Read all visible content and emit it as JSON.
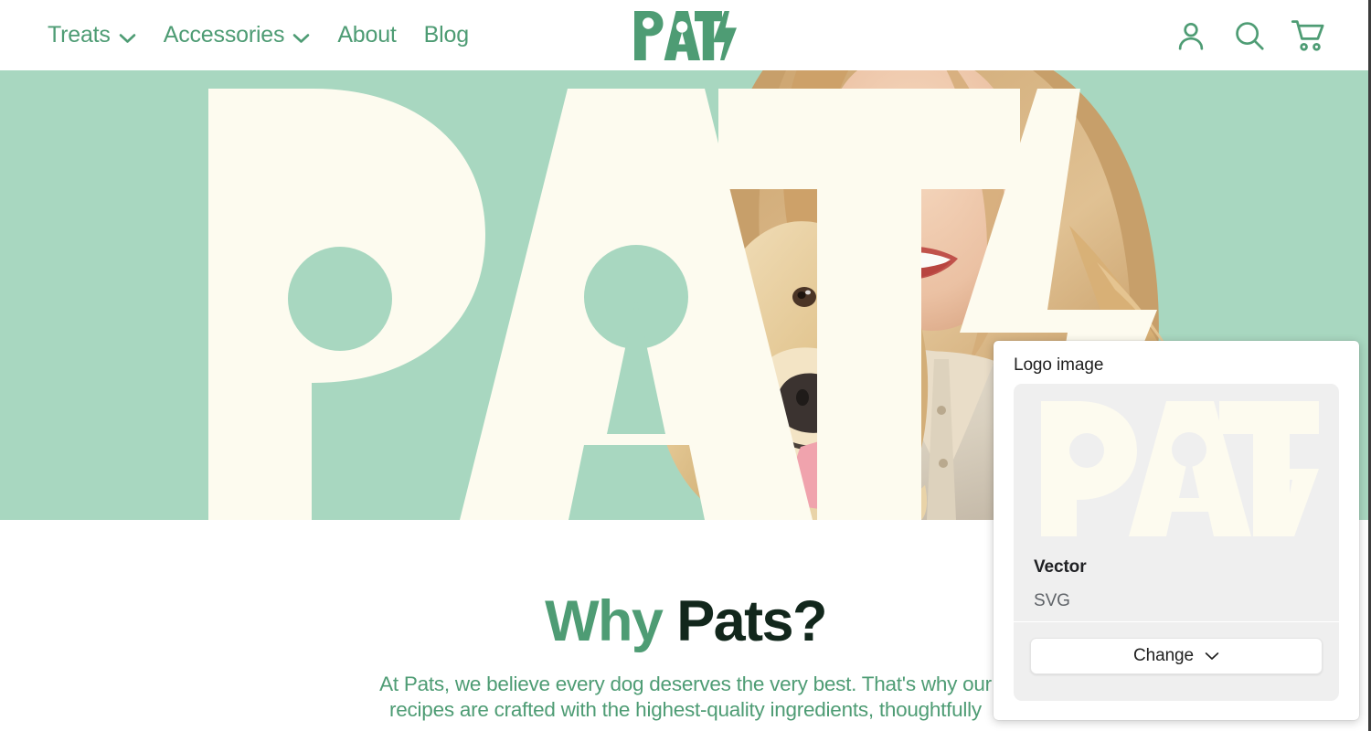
{
  "header": {
    "nav": [
      {
        "label": "Treats",
        "has_dropdown": true,
        "icon": "chevron-down-icon"
      },
      {
        "label": "Accessories",
        "has_dropdown": true,
        "icon": "chevron-down-icon"
      },
      {
        "label": "About",
        "has_dropdown": false
      },
      {
        "label": "Blog",
        "has_dropdown": false
      }
    ],
    "logo_text": "PATS",
    "actions": [
      {
        "name": "account-icon",
        "label": "Account"
      },
      {
        "name": "search-icon",
        "label": "Search"
      },
      {
        "name": "cart-icon",
        "label": "Cart"
      }
    ]
  },
  "hero": {
    "wordmark": "PATS",
    "image_alt": "Woman hugging a golden retriever"
  },
  "why": {
    "title_accent": "Why",
    "title_main": "Pats?",
    "body": "At Pats, we believe every dog deserves the very best. That's why our recipes are crafted with the highest-quality ingredients, thoughtfully"
  },
  "popover": {
    "title": "Logo image",
    "preview_wordmark": "PATS",
    "kind": "Vector",
    "format": "SVG",
    "change_label": "Change",
    "change_icon": "chevron-down-icon"
  },
  "colors": {
    "brand_green": "#4e9c74",
    "hero_mint": "#a8d7c0",
    "cream": "#fdfbef",
    "dark_text": "#12271c",
    "panel_gray": "#efefef"
  }
}
